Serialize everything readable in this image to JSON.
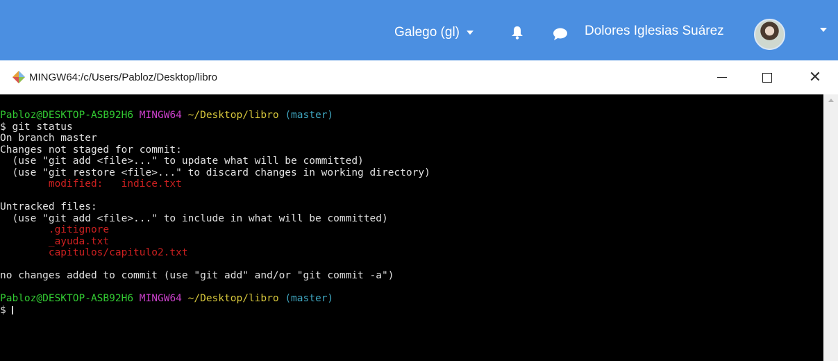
{
  "topbar": {
    "language": "Galego (gl)",
    "user_name": "Dolores Iglesias Suárez",
    "icons": [
      "bell-icon",
      "chat-icon",
      "avatar",
      "chevron-down-icon"
    ],
    "brand_color": "#4b8fe1"
  },
  "window": {
    "title": "MINGW64:/c/Users/Pabloz/Desktop/libro",
    "controls": [
      "minimize",
      "maximize",
      "close"
    ]
  },
  "terminal": {
    "prompt": {
      "user_host": "Pabloz@DESKTOP-ASB92H6",
      "env": "MINGW64",
      "path": "~/Desktop/libro",
      "branch": "(master)"
    },
    "command": "$ git status",
    "lines": {
      "on_branch": "On branch master",
      "not_staged": "Changes not staged for commit:",
      "hint_add": "  (use \"git add <file>...\" to update what will be committed)",
      "hint_restore": "  (use \"git restore <file>...\" to discard changes in working directory)",
      "modified": "        modified:   indice.txt",
      "untracked": "Untracked files:",
      "hint_include": "  (use \"git add <file>...\" to include in what will be committed)",
      "no_changes": "no changes added to commit (use \"git add\" and/or \"git commit -a\")"
    },
    "untracked_files": [
      "        .gitignore",
      "        _ayuda.txt",
      "        capitulos/capitulo2.txt"
    ],
    "final_prompt_symbol": "$ ",
    "colors": {
      "user_host": "#32c932",
      "env": "#c83fc8",
      "path": "#d6c63c",
      "branch": "#3fa6c0",
      "changed": "#cc2020"
    }
  }
}
